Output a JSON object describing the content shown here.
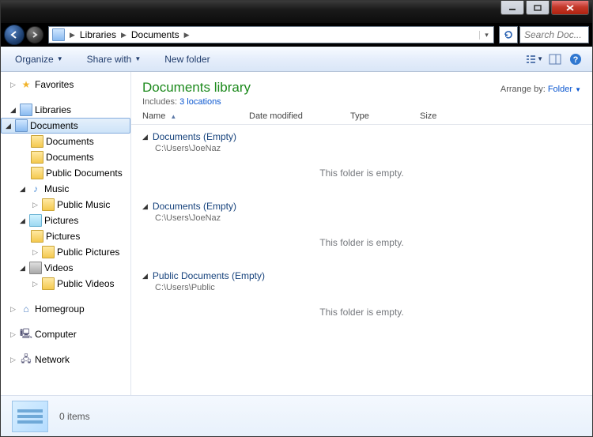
{
  "breadcrumbs": [
    "Libraries",
    "Documents"
  ],
  "search": {
    "placeholder": "Search Doc..."
  },
  "toolbar": {
    "organize": "Organize",
    "share": "Share with",
    "newfolder": "New folder"
  },
  "sidebar": {
    "favorites": "Favorites",
    "libraries": "Libraries",
    "documents": "Documents",
    "documents_sub1": "Documents",
    "documents_sub2": "Documents",
    "public_documents": "Public Documents",
    "music": "Music",
    "public_music": "Public Music",
    "pictures": "Pictures",
    "pictures_sub": "Pictures",
    "public_pictures": "Public Pictures",
    "videos": "Videos",
    "public_videos": "Public Videos",
    "homegroup": "Homegroup",
    "computer": "Computer",
    "network": "Network"
  },
  "library": {
    "title": "Documents library",
    "includes_label": "Includes:",
    "includes_link": "3 locations",
    "arrange_label": "Arrange by:",
    "arrange_value": "Folder"
  },
  "columns": {
    "name": "Name",
    "date": "Date modified",
    "type": "Type",
    "size": "Size"
  },
  "groups": [
    {
      "name": "Documents (Empty)",
      "path": "C:\\Users\\JoeNaz",
      "empty": "This folder is empty."
    },
    {
      "name": "Documents (Empty)",
      "path": "C:\\Users\\JoeNaz",
      "empty": "This folder is empty."
    },
    {
      "name": "Public Documents (Empty)",
      "path": "C:\\Users\\Public",
      "empty": "This folder is empty."
    }
  ],
  "details": {
    "count": "0 items"
  }
}
